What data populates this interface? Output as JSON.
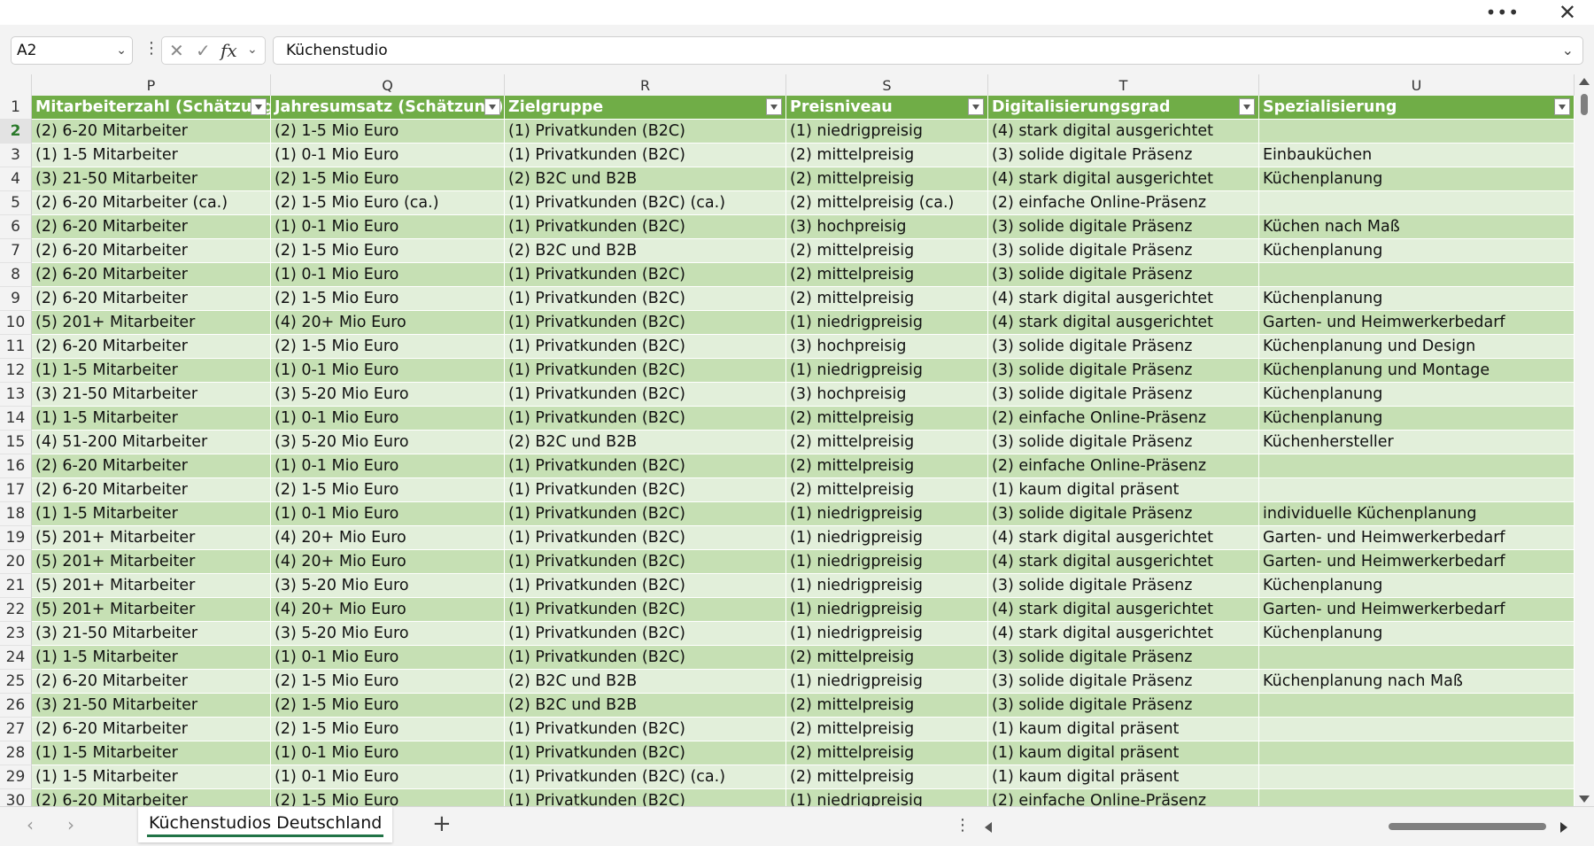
{
  "window": {
    "more_icon": "more-horizontal-icon",
    "close_icon": "close-icon"
  },
  "formula_bar": {
    "name_box": "A2",
    "formula": "Küchenstudio"
  },
  "columns": [
    {
      "letter": "P",
      "header": "Mitarbeiterzahl (Schätzung)"
    },
    {
      "letter": "Q",
      "header": "Jahresumsatz (Schätzung)"
    },
    {
      "letter": "R",
      "header": "Zielgruppe"
    },
    {
      "letter": "S",
      "header": "Preisniveau"
    },
    {
      "letter": "T",
      "header": "Digitalisierungsgrad"
    },
    {
      "letter": "U",
      "header": "Spezialisierung"
    }
  ],
  "rows": [
    {
      "n": "2",
      "c": [
        "(2) 6-20 Mitarbeiter",
        "(2) 1-5 Mio Euro",
        "(1) Privatkunden (B2C)",
        "(1) niedrigpreisig",
        "(4) stark digital ausgerichtet",
        ""
      ]
    },
    {
      "n": "3",
      "c": [
        "(1) 1-5 Mitarbeiter",
        "(1) 0-1 Mio Euro",
        "(1) Privatkunden (B2C)",
        "(2) mittelpreisig",
        "(3) solide digitale Präsenz",
        "Einbauküchen"
      ]
    },
    {
      "n": "4",
      "c": [
        "(3) 21-50 Mitarbeiter",
        "(2) 1-5 Mio Euro",
        "(2) B2C und B2B",
        "(2) mittelpreisig",
        "(4) stark digital ausgerichtet",
        "Küchenplanung"
      ]
    },
    {
      "n": "5",
      "c": [
        "(2) 6-20 Mitarbeiter (ca.)",
        "(2) 1-5 Mio Euro (ca.)",
        "(1) Privatkunden (B2C) (ca.)",
        "(2) mittelpreisig (ca.)",
        "(2) einfache Online-Präsenz",
        ""
      ]
    },
    {
      "n": "6",
      "c": [
        "(2) 6-20 Mitarbeiter",
        "(1) 0-1 Mio Euro",
        "(1) Privatkunden (B2C)",
        "(3) hochpreisig",
        "(3) solide digitale Präsenz",
        "Küchen nach Maß"
      ]
    },
    {
      "n": "7",
      "c": [
        "(2) 6-20 Mitarbeiter",
        "(2) 1-5 Mio Euro",
        "(2) B2C und B2B",
        "(2) mittelpreisig",
        "(3) solide digitale Präsenz",
        "Küchenplanung"
      ]
    },
    {
      "n": "8",
      "c": [
        "(2) 6-20 Mitarbeiter",
        "(1) 0-1 Mio Euro",
        "(1) Privatkunden (B2C)",
        "(2) mittelpreisig",
        "(3) solide digitale Präsenz",
        ""
      ]
    },
    {
      "n": "9",
      "c": [
        "(2) 6-20 Mitarbeiter",
        "(2) 1-5 Mio Euro",
        "(1) Privatkunden (B2C)",
        "(2) mittelpreisig",
        "(4) stark digital ausgerichtet",
        "Küchenplanung"
      ]
    },
    {
      "n": "10",
      "c": [
        "(5) 201+ Mitarbeiter",
        "(4) 20+ Mio Euro",
        "(1) Privatkunden (B2C)",
        "(1) niedrigpreisig",
        "(4) stark digital ausgerichtet",
        "Garten- und Heimwerkerbedarf"
      ]
    },
    {
      "n": "11",
      "c": [
        "(2) 6-20 Mitarbeiter",
        "(2) 1-5 Mio Euro",
        "(1) Privatkunden (B2C)",
        "(3) hochpreisig",
        "(3) solide digitale Präsenz",
        "Küchenplanung und Design"
      ]
    },
    {
      "n": "12",
      "c": [
        "(1) 1-5 Mitarbeiter",
        "(1) 0-1 Mio Euro",
        "(1) Privatkunden (B2C)",
        "(1) niedrigpreisig",
        "(3) solide digitale Präsenz",
        "Küchenplanung und Montage"
      ]
    },
    {
      "n": "13",
      "c": [
        "(3) 21-50 Mitarbeiter",
        "(3) 5-20 Mio Euro",
        "(1) Privatkunden (B2C)",
        "(3) hochpreisig",
        "(3) solide digitale Präsenz",
        "Küchenplanung"
      ]
    },
    {
      "n": "14",
      "c": [
        "(1) 1-5 Mitarbeiter",
        "(1) 0-1 Mio Euro",
        "(1) Privatkunden (B2C)",
        "(2) mittelpreisig",
        "(2) einfache Online-Präsenz",
        "Küchenplanung"
      ]
    },
    {
      "n": "15",
      "c": [
        "(4) 51-200 Mitarbeiter",
        "(3) 5-20 Mio Euro",
        "(2) B2C und B2B",
        "(2) mittelpreisig",
        "(3) solide digitale Präsenz",
        "Küchenhersteller"
      ]
    },
    {
      "n": "16",
      "c": [
        "(2) 6-20 Mitarbeiter",
        "(1) 0-1 Mio Euro",
        "(1) Privatkunden (B2C)",
        "(2) mittelpreisig",
        "(2) einfache Online-Präsenz",
        ""
      ]
    },
    {
      "n": "17",
      "c": [
        "(2) 6-20 Mitarbeiter",
        "(2) 1-5 Mio Euro",
        "(1) Privatkunden (B2C)",
        "(2) mittelpreisig",
        "(1) kaum digital präsent",
        ""
      ]
    },
    {
      "n": "18",
      "c": [
        "(1) 1-5 Mitarbeiter",
        "(1) 0-1 Mio Euro",
        "(1) Privatkunden (B2C)",
        "(1) niedrigpreisig",
        "(3) solide digitale Präsenz",
        "individuelle Küchenplanung"
      ]
    },
    {
      "n": "19",
      "c": [
        "(5) 201+ Mitarbeiter",
        "(4) 20+ Mio Euro",
        "(1) Privatkunden (B2C)",
        "(1) niedrigpreisig",
        "(4) stark digital ausgerichtet",
        "Garten- und Heimwerkerbedarf"
      ]
    },
    {
      "n": "20",
      "c": [
        "(5) 201+ Mitarbeiter",
        "(4) 20+ Mio Euro",
        "(1) Privatkunden (B2C)",
        "(1) niedrigpreisig",
        "(4) stark digital ausgerichtet",
        "Garten- und Heimwerkerbedarf"
      ]
    },
    {
      "n": "21",
      "c": [
        "(5) 201+ Mitarbeiter",
        "(3) 5-20 Mio Euro",
        "(1) Privatkunden (B2C)",
        "(1) niedrigpreisig",
        "(3) solide digitale Präsenz",
        "Küchenplanung"
      ]
    },
    {
      "n": "22",
      "c": [
        "(5) 201+ Mitarbeiter",
        "(4) 20+ Mio Euro",
        "(1) Privatkunden (B2C)",
        "(1) niedrigpreisig",
        "(4) stark digital ausgerichtet",
        "Garten- und Heimwerkerbedarf"
      ]
    },
    {
      "n": "23",
      "c": [
        "(3) 21-50 Mitarbeiter",
        "(3) 5-20 Mio Euro",
        "(1) Privatkunden (B2C)",
        "(1) niedrigpreisig",
        "(4) stark digital ausgerichtet",
        "Küchenplanung"
      ]
    },
    {
      "n": "24",
      "c": [
        "(1) 1-5 Mitarbeiter",
        "(1) 0-1 Mio Euro",
        "(1) Privatkunden (B2C)",
        "(2) mittelpreisig",
        "(3) solide digitale Präsenz",
        ""
      ]
    },
    {
      "n": "25",
      "c": [
        "(2) 6-20 Mitarbeiter",
        "(2) 1-5 Mio Euro",
        "(2) B2C und B2B",
        "(1) niedrigpreisig",
        "(3) solide digitale Präsenz",
        "Küchenplanung nach Maß"
      ]
    },
    {
      "n": "26",
      "c": [
        "(3) 21-50 Mitarbeiter",
        "(2) 1-5 Mio Euro",
        "(2) B2C und B2B",
        "(2) mittelpreisig",
        "(3) solide digitale Präsenz",
        ""
      ]
    },
    {
      "n": "27",
      "c": [
        "(2) 6-20 Mitarbeiter",
        "(2) 1-5 Mio Euro",
        "(1) Privatkunden (B2C)",
        "(2) mittelpreisig",
        "(1) kaum digital präsent",
        ""
      ]
    },
    {
      "n": "28",
      "c": [
        "(1) 1-5 Mitarbeiter",
        "(1) 0-1 Mio Euro",
        "(1) Privatkunden (B2C)",
        "(2) mittelpreisig",
        "(1) kaum digital präsent",
        ""
      ]
    },
    {
      "n": "29",
      "c": [
        "(1) 1-5 Mitarbeiter",
        "(1) 0-1 Mio Euro",
        "(1) Privatkunden (B2C) (ca.)",
        "(2) mittelpreisig",
        "(1) kaum digital präsent",
        ""
      ]
    },
    {
      "n": "30",
      "c": [
        "(2) 6-20 Mitarbeiter",
        "(2) 1-5 Mio Euro",
        "(1) Privatkunden (B2C)",
        "(1) niedrigpreisig",
        "(2) einfache Online-Präsenz",
        ""
      ]
    }
  ],
  "sheet_tab": {
    "label": "Küchenstudios Deutschland",
    "add_icon": "plus-icon"
  },
  "colors": {
    "header_green": "#70ad47",
    "band_dark": "#c6e0b4",
    "band_light": "#e2efda",
    "tab_underline": "#217346"
  }
}
